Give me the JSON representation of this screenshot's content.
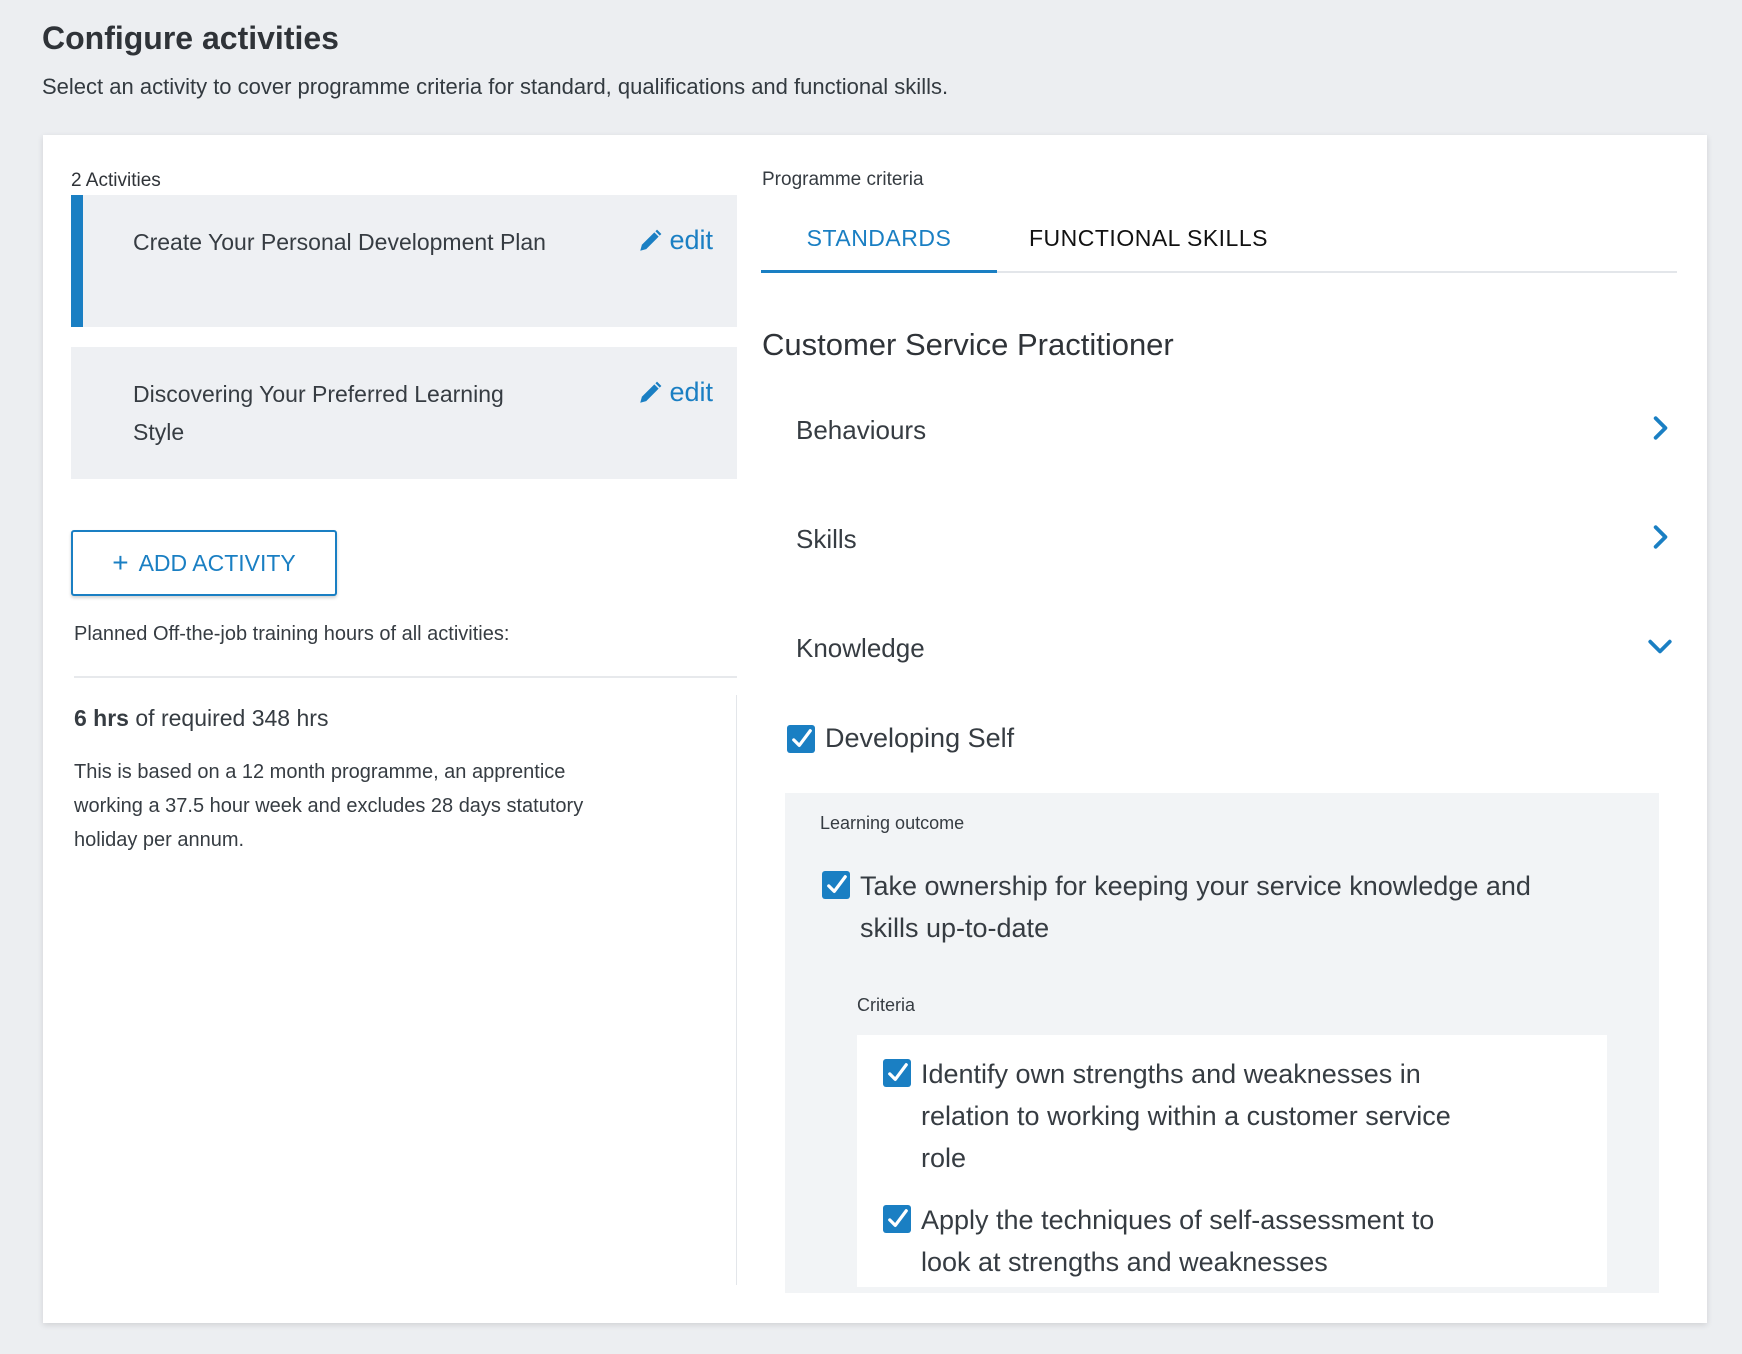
{
  "page": {
    "title": "Configure activities",
    "subtitle": "Select an activity to cover programme criteria for standard, qualifications and functional skills."
  },
  "activities": {
    "count_label": "2 Activities",
    "items": [
      {
        "title": "Create Your Personal Development Plan",
        "edit_label": "edit",
        "active": true
      },
      {
        "title": "Discovering Your Preferred Learning Style",
        "edit_label": "edit",
        "active": false
      }
    ],
    "add_button_label": "ADD ACTIVITY",
    "planned_label": "Planned Off-the-job training hours of all activities:",
    "hours_value": "6 hrs",
    "hours_rest": " of required 348 hrs",
    "hours_note": "This is based on a 12 month programme, an apprentice working a 37.5 hour week and excludes 28 days statutory holiday per annum."
  },
  "criteria": {
    "label": "Programme criteria",
    "tabs": [
      {
        "label": "STANDARDS",
        "selected": true
      },
      {
        "label": "FUNCTIONAL SKILLS",
        "selected": false
      }
    ],
    "standard_title": "Customer Service Practitioner",
    "sections": [
      {
        "label": "Behaviours",
        "expanded": false,
        "icon": "chevron-right-icon"
      },
      {
        "label": "Skills",
        "expanded": false,
        "icon": "chevron-right-icon"
      },
      {
        "label": "Knowledge",
        "expanded": true,
        "icon": "chevron-down-icon"
      }
    ],
    "knowledge": {
      "topic": {
        "label": "Developing Self",
        "checked": true
      },
      "learning_outcome_label": "Learning outcome",
      "learning_outcome": {
        "label": "Take ownership for keeping your service knowledge and skills up-to-date",
        "checked": true
      },
      "criteria_label": "Criteria",
      "criteria": [
        {
          "label": "Identify own strengths and weaknesses in relation to working within a customer service role",
          "checked": true
        },
        {
          "label": "Apply the techniques of self-assessment to look at strengths and weaknesses",
          "checked": true
        }
      ]
    }
  },
  "colors": {
    "accent": "#1a7fc3",
    "background": "#eceef1",
    "panel": "#eef0f3"
  }
}
